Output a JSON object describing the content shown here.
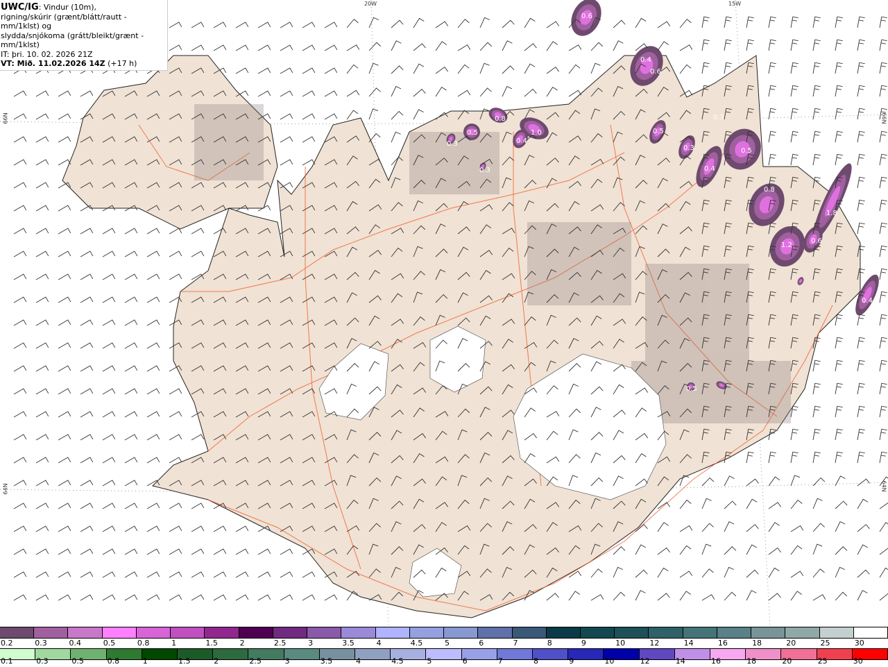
{
  "header": {
    "product": "UWC/IG",
    "line1": ": Vindur (10m),",
    "line2": "rigning/skúrir (grænt/blátt/rautt - mm/1klst) og",
    "line3": "slydda/snjókoma (grátt/bleikt/grænt - mm/1klst)",
    "it": "IT: þri. 10. 02. 2026 21Z",
    "vt": "VT: Mið. 11.02.2026 14Z",
    "vt_offset": " (+17 h)"
  },
  "grid_labels": {
    "lon20": "20W",
    "lon15": "15W",
    "lat66_left": "66N",
    "lat66_right": "66N",
    "lat64_left": "64N",
    "lat64_right": "64N"
  },
  "precip_labels": [
    "0.6",
    "0.4",
    "0.6",
    "0.8",
    "0.5",
    "0.3",
    "1.0",
    "0.4",
    "0.3",
    "0.5",
    "0.3",
    "0.4",
    "0.5",
    "0.8",
    "1.8",
    "1.2",
    "0.6",
    "0.4",
    "0.5",
    "0.3"
  ],
  "legend_top": {
    "labels": [
      "0.2",
      "0.3",
      "0.4",
      "0.5",
      "0.8",
      "1",
      "1.5",
      "2",
      "2.5",
      "3",
      "3.5",
      "4",
      "4.5",
      "5",
      "6",
      "7",
      "8",
      "9",
      "10",
      "12",
      "14",
      "16",
      "18",
      "20",
      "25",
      "30"
    ],
    "colors": [
      "#6e4a6e",
      "#a0609f",
      "#c878c8",
      "#ff80ff",
      "#d864d8",
      "#c050c0",
      "#902890",
      "#500050",
      "#702a80",
      "#8a5aaa",
      "#9a8ad8",
      "#b0b4ff",
      "#94a0e0",
      "#8898d0",
      "#6070a8",
      "#3a5878",
      "#0a3a48",
      "#144850",
      "#1e5058",
      "#306068",
      "#447478",
      "#5a8088",
      "#789498",
      "#90a8a8",
      "#c4d0d0",
      "#ffffff"
    ]
  },
  "legend_bottom": {
    "labels": [
      "0.1",
      "0.3",
      "0.5",
      "0.8",
      "1",
      "1.5",
      "2",
      "2.5",
      "3",
      "3.5",
      "4",
      "4.5",
      "5",
      "6",
      "7",
      "8",
      "9",
      "10",
      "12",
      "14",
      "16",
      "18",
      "20",
      "25",
      "30"
    ],
    "colors": [
      "#d0fcd0",
      "#a0d8a0",
      "#70b070",
      "#2e7a30",
      "#004800",
      "#1c5a28",
      "#2e6a40",
      "#447a60",
      "#5a8a80",
      "#7890a0",
      "#90a0c0",
      "#a8b0e0",
      "#bcbcff",
      "#98a0e8",
      "#7078d8",
      "#5050c8",
      "#2828b8",
      "#0000a8",
      "#6048c0",
      "#c090e8",
      "#f8a8f0",
      "#f090c8",
      "#f07098",
      "#f04050",
      "#ff0000"
    ]
  },
  "colors": {
    "land": "#f0e2d4",
    "roads": "#f06030",
    "glacier": "#ffffff",
    "precip_dark": "#6e4a6e",
    "precip_mid": "#a0609f",
    "precip_light": "#e070e0"
  }
}
